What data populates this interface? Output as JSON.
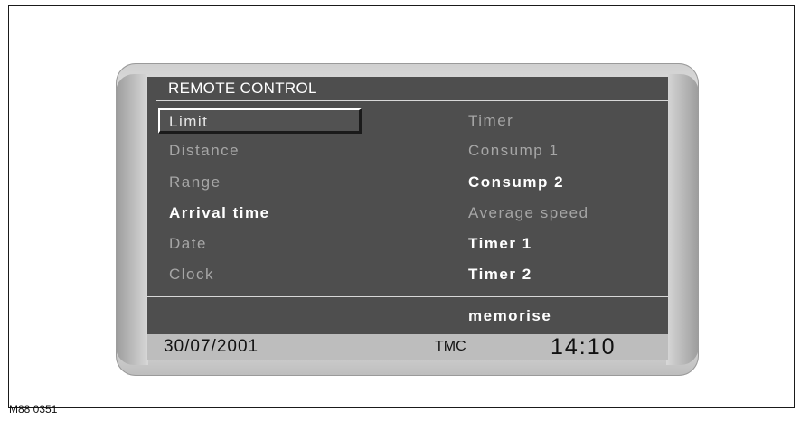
{
  "screen": {
    "title": "REMOTE CONTROL",
    "selected_item": "Limit",
    "left_items": [
      {
        "label": "Limit"
      },
      {
        "label": "Distance"
      },
      {
        "label": "Range"
      },
      {
        "label": "Arrival  time"
      },
      {
        "label": "Date"
      },
      {
        "label": "Clock"
      }
    ],
    "right_items": [
      {
        "label": "Timer"
      },
      {
        "label": "Consump  1"
      },
      {
        "label": "Consump  2"
      },
      {
        "label": "Average  speed"
      },
      {
        "label": "Timer  1"
      },
      {
        "label": "Timer  2"
      }
    ],
    "memorise_label": "memorise"
  },
  "status_bar": {
    "date": "30/07/2001",
    "tmc": "TMC",
    "clock": "14:10"
  },
  "figure_id": "M88 0351",
  "colors": {
    "screen_bg": "#4e4e4e",
    "bright_text": "#ffffff",
    "dim_text": "#a6a6a6",
    "status_bg": "#bdbdbd"
  }
}
